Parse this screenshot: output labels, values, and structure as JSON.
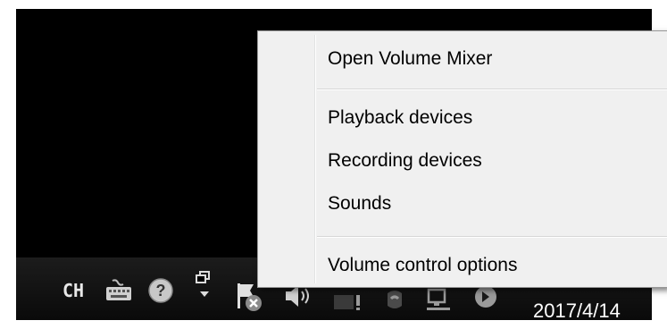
{
  "context_menu": {
    "items": [
      {
        "label": "Open Volume Mixer"
      },
      {
        "label": "Playback devices"
      },
      {
        "label": "Recording devices"
      },
      {
        "label": "Sounds"
      },
      {
        "label": "Volume control options"
      }
    ]
  },
  "taskbar": {
    "language": "CH",
    "clock_date": "2017/4/14",
    "tray_icons": [
      "keyboard-icon",
      "help-icon",
      "window-restore-icon",
      "action-center-flag-icon",
      "speaker-volume-icon",
      "monitor-icon",
      "sync-icon",
      "network-icon",
      "update-icon"
    ]
  },
  "colors": {
    "menu_background": "#f0f0f0",
    "desktop_background": "#000000",
    "taskbar_background": "#111111"
  }
}
